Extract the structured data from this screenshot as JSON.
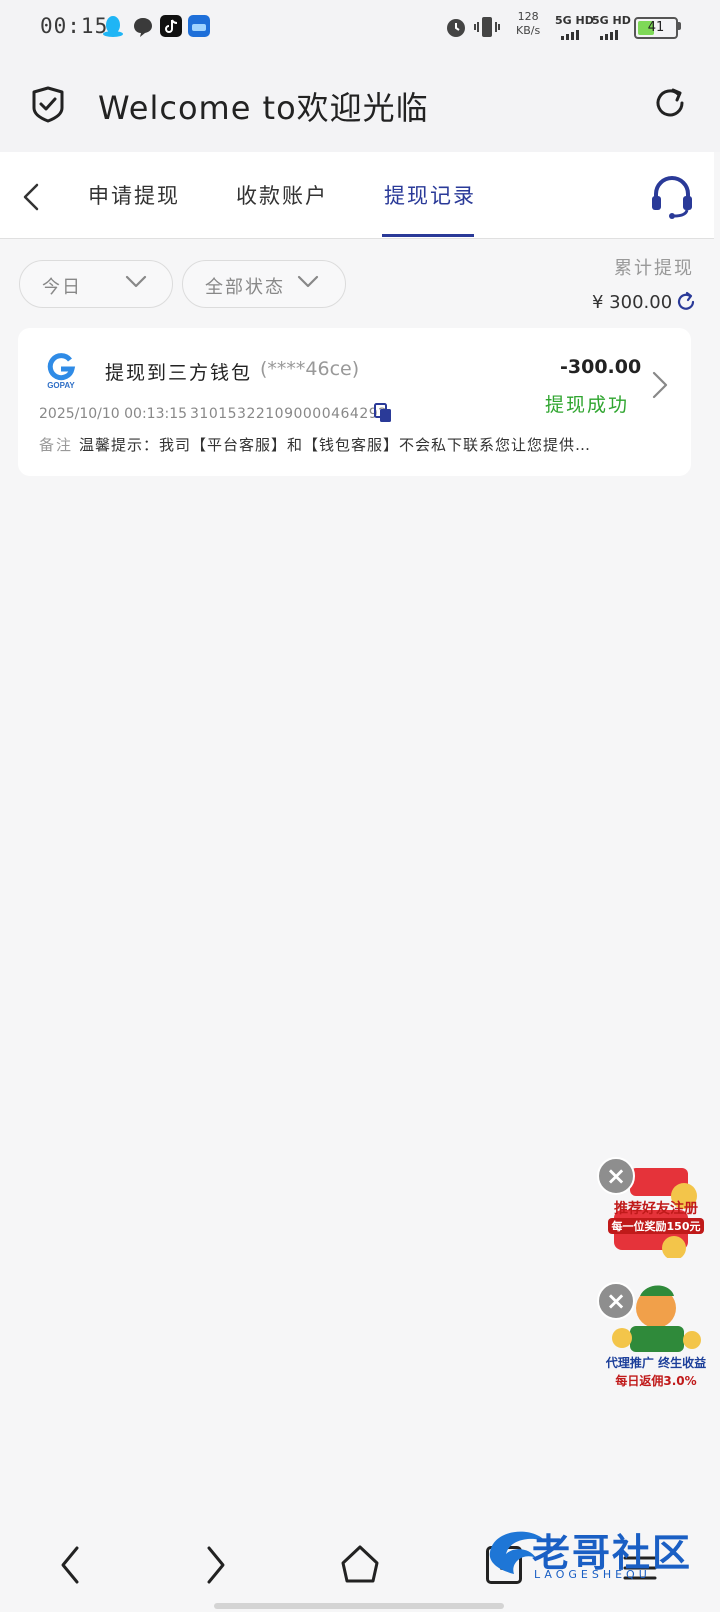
{
  "status_bar": {
    "time": "00:15",
    "net_speed_value": "128",
    "net_speed_unit": "KB/s",
    "net1": "5G HD",
    "net2": "5G HD",
    "battery": "41",
    "icons": [
      "qq-icon",
      "message-icon",
      "tiktok-icon",
      "app-icon",
      "alarm-icon",
      "vibrate-icon"
    ]
  },
  "header": {
    "title": "Welcome to欢迎光临"
  },
  "tabs": [
    {
      "label": "申请提现",
      "active": false
    },
    {
      "label": "收款账户",
      "active": false
    },
    {
      "label": "提现记录",
      "active": true
    }
  ],
  "filters": {
    "date": "今日",
    "status": "全部状态"
  },
  "total": {
    "label": "累计提现",
    "value": "¥ 300.00"
  },
  "record": {
    "logo_text": "GOPAY",
    "title": "提现到三方钱包",
    "account": "(****46ce)",
    "amount": "-300.00",
    "status": "提现成功",
    "datetime": "2025/10/10 00:13:15",
    "order_no": "310153221090000464292",
    "remark_label": "备注",
    "remark": "温馨提示：我司【平台客服】和【钱包客服】不会私下联系您让您提供…"
  },
  "promos": {
    "p1_line1": "推荐好友注册",
    "p1_line2": "每一位奖励150元",
    "p2_line1": "代理推广 终生收益",
    "p2_line2": "每日返佣3.0%"
  },
  "nav": {
    "tab_count": "3"
  },
  "watermark": "老哥社区",
  "watermark_sub": "LAOGESHEQU",
  "colors": {
    "accent": "#2a3a98",
    "success": "#2fa52f",
    "promo_red": "#e5333a"
  }
}
